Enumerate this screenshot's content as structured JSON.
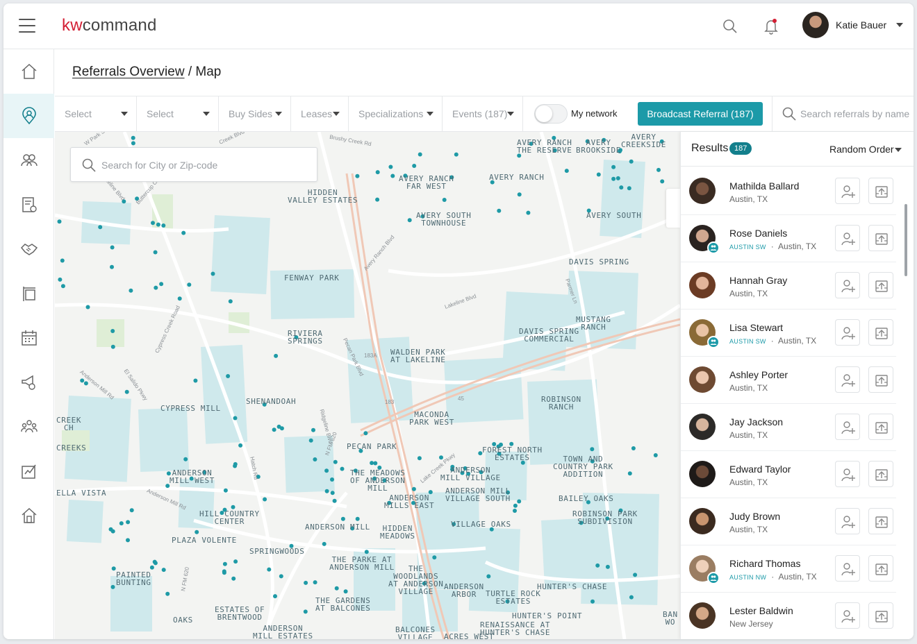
{
  "app": {
    "logo_kw": "kw",
    "logo_rest": "command"
  },
  "header": {
    "user_name": "Katie Bauer",
    "search_icon": "search-icon",
    "bell_icon": "bell-icon",
    "notification_dot_color": "#d31f34"
  },
  "nav": {
    "items": [
      {
        "icon": "home-icon"
      },
      {
        "icon": "referrals-map-pin-icon",
        "active": true
      },
      {
        "icon": "contacts-icon"
      },
      {
        "icon": "documents-icon"
      },
      {
        "icon": "handshake-icon"
      },
      {
        "icon": "listing-sign-icon"
      },
      {
        "icon": "calendar-icon"
      },
      {
        "icon": "megaphone-icon"
      },
      {
        "icon": "team-icon"
      },
      {
        "icon": "reports-icon"
      },
      {
        "icon": "house-icon"
      }
    ]
  },
  "breadcrumb": {
    "link": "Referrals Overview",
    "separator": " / ",
    "current": "Map"
  },
  "filters": {
    "items": [
      "Select",
      "Select",
      "Buy Sides",
      "Leases",
      "Specializations",
      "Events (187)"
    ],
    "toggle_label": "My network",
    "toggle_on": false,
    "broadcast_label": "Broadcast Referral (187)",
    "search_placeholder": "Search referrals by name"
  },
  "map": {
    "search_placeholder": "Search for City or Zip-code",
    "pin_color": "#1e9aa6",
    "park_color": "#cfe9ec",
    "highway_color": "#f0c8b6",
    "labels": [
      "AVERY RANCH\nTHE RESERVE",
      "AVERY\nBROOKSIDE",
      "AVERY\nCREEKSIDE",
      "AVERY RANCH\nFAR WEST",
      "AVERY RANCH",
      "AVERY SOUTH\nTOWNHOUSE",
      "AVERY SOUTH",
      "HIDDEN\nVALLEY ESTATES",
      "DAVIS SPRING",
      "FENWAY PARK",
      "RIVIERA\nSPRINGS",
      "MUSTANG\nRANCH",
      "DAVIS SPRING\nCOMMERCIAL",
      "WALDEN PARK\nAT LAKELINE",
      "SHENANDOAH",
      "CYPRESS MILL",
      "ROBINSON\nRANCH",
      "MACONDA\nPARK WEST",
      "PECAN PARK",
      "FOREST NORTH\nESTATES",
      "TOWN AND\nCOUNTRY PARK\nADDITION",
      "ANDERSON\nMILL WEST",
      "THE MEADOWS\nOF ANDERSON\nMILL",
      "ANDERSON\nMILL VILLAGE",
      "ANDERSON MILL\nVILLAGE SOUTH",
      "ANDERSON\nMILLS EAST",
      "BAILEY OAKS",
      "HILL COUNTRY\nCENTER",
      "ANDERSON MILL",
      "HIDDEN\nMEADOWS",
      "VILLAGE OAKS",
      "ROBINSON PARK\nSUBDIVISION",
      "PLAZA VOLENTE",
      "SPRINGWOODS",
      "THE PARKE AT\nANDERSON MILL",
      "THE\nWOODLANDS\nAT ANDERSON\nVILLAGE",
      "ACRES WEST",
      "PAINTED\nBUNTING",
      "ANDERSON\nARBOR",
      "HUNTER'S CHASE",
      "TURTLE ROCK\nESTATES",
      "THE GARDENS\nAT BALCONES",
      "ESTATES OF\nBRENTWOOD",
      "HUNTER'S POINT",
      "RENAISSANCE AT\nHUNTER'S CHASE",
      "OAKS",
      "ANDERSON\nMILL ESTATES",
      "BALCONES\nVILLAGE",
      "CREEK\nCH",
      "CREEKS",
      "ELLA VISTA",
      "BAN\nWO"
    ],
    "streets": [
      "W Park St",
      "Creek Blvd",
      "Brushy Creek Rd",
      "Lakeline Blvd",
      "Buttercup Creek Blvd",
      "Cypress Creek Road",
      "Avery Ranch Blvd",
      "Lakeline Blvd",
      "Parmer Ln",
      "Anderson Mill Rd",
      "El Salido Pkwy",
      "Ridgeline Blvd",
      "N FM 620",
      "Lake Creek Pkwy",
      "Anderson Mill Rd",
      "N FM 620",
      "183",
      "45",
      "183A",
      "Hatch Rd",
      "Pecan Park Blvd"
    ]
  },
  "results": {
    "title": "Results",
    "count": "187",
    "sort_label": "Random Order",
    "agents": [
      {
        "name": "Mathilda Ballard",
        "team": "",
        "location": "Austin, TX",
        "in_network": false,
        "avatar_colors": [
          "#3a2b22",
          "#7a5541"
        ]
      },
      {
        "name": "Rose Daniels",
        "team": "AUSTIN SW",
        "location": "Austin, TX",
        "in_network": true,
        "avatar_colors": [
          "#2a2320",
          "#d1a890"
        ]
      },
      {
        "name": "Hannah Gray",
        "team": "",
        "location": "Austin, TX",
        "in_network": false,
        "avatar_colors": [
          "#6b3b24",
          "#e2b49a"
        ]
      },
      {
        "name": "Lisa Stewart",
        "team": "AUSTIN SW",
        "location": "Austin, TX",
        "in_network": true,
        "avatar_colors": [
          "#8a6a36",
          "#e9c4a6"
        ]
      },
      {
        "name": "Ashley Porter",
        "team": "",
        "location": "Austin, TX",
        "in_network": false,
        "avatar_colors": [
          "#6e4a32",
          "#ebc6ae"
        ]
      },
      {
        "name": "Jay Jackson",
        "team": "",
        "location": "Austin, TX",
        "in_network": false,
        "avatar_colors": [
          "#2c2a28",
          "#d7b59d"
        ]
      },
      {
        "name": "Edward Taylor",
        "team": "",
        "location": "Austin, TX",
        "in_network": false,
        "avatar_colors": [
          "#1e1a18",
          "#6b4a38"
        ]
      },
      {
        "name": "Judy Brown",
        "team": "",
        "location": "Austin, TX",
        "in_network": false,
        "avatar_colors": [
          "#3b2a1f",
          "#c9956f"
        ]
      },
      {
        "name": "Richard Thomas",
        "team": "AUSTIN NW",
        "location": "Austin, TX",
        "in_network": true,
        "avatar_colors": [
          "#9a7d62",
          "#eed0ba"
        ]
      },
      {
        "name": "Lester Baldwin",
        "team": "",
        "location": "New Jersey",
        "in_network": false,
        "avatar_colors": [
          "#4a3424",
          "#d5a887"
        ]
      }
    ],
    "add_icon": "add-contact-icon",
    "send_icon": "send-referral-icon"
  }
}
